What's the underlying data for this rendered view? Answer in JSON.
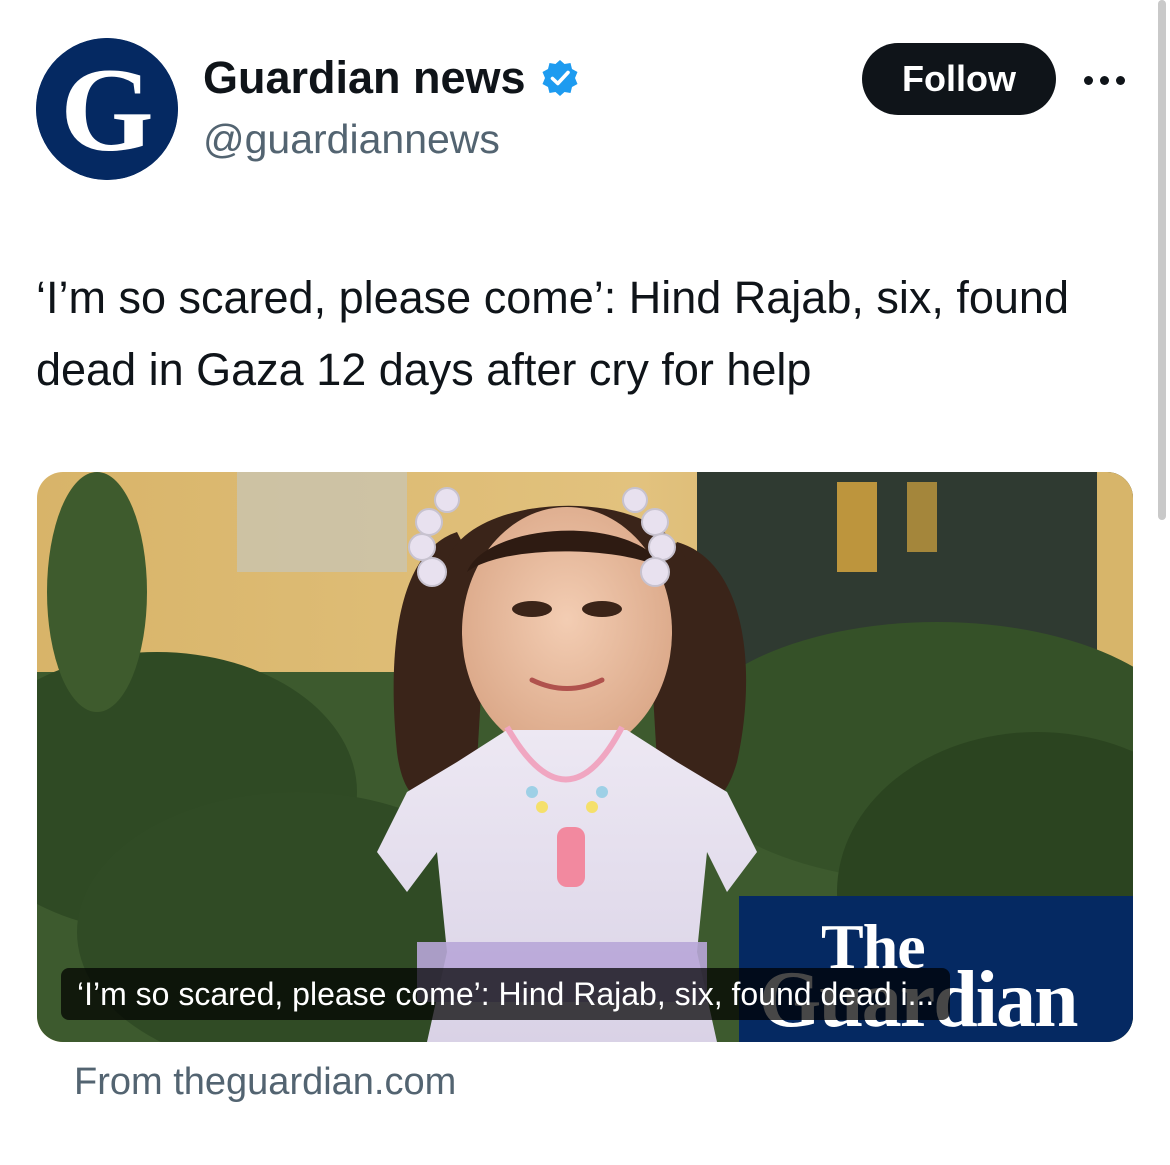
{
  "account": {
    "display_name": "Guardian news",
    "handle": "@guardiannews",
    "avatar_letter": "G",
    "verified": true,
    "follow_label": "Follow"
  },
  "tweet": {
    "text": "‘I’m so scared, please come’: Hind Rajab, six, found dead in Gaza 12 days after cry for help"
  },
  "card": {
    "brand_line1": "The",
    "brand_line2": "Guardian",
    "caption": "‘I’m so scared, please come’: Hind Rajab, six, found dead i...",
    "source": "From theguardian.com"
  },
  "colors": {
    "guardian_blue": "#052962",
    "verified_blue": "#1d9bf0",
    "secondary_text": "#536471",
    "follow_bg": "#0f1419"
  }
}
